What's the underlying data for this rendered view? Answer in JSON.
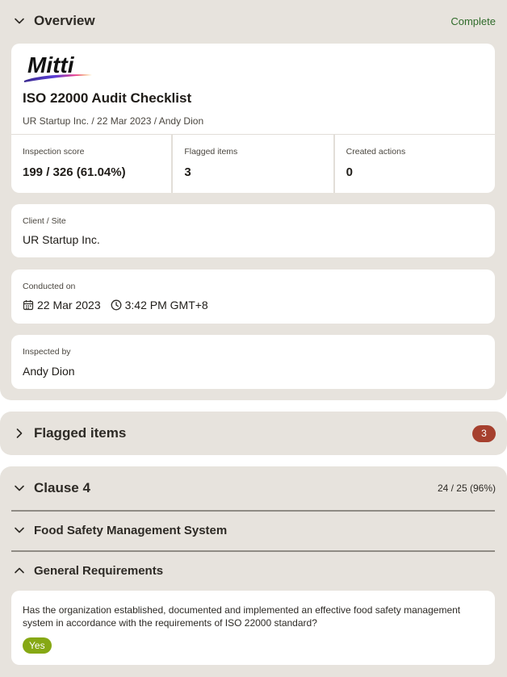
{
  "overview": {
    "title": "Overview",
    "status": "Complete",
    "report": {
      "logo_text": "Mitti",
      "title": "ISO 22000 Audit Checklist",
      "meta": "UR Startup Inc. / 22 Mar 2023 / Andy Dion"
    },
    "stats": [
      {
        "label": "Inspection score",
        "value": "199 / 326 (61.04%)"
      },
      {
        "label": "Flagged items",
        "value": "3"
      },
      {
        "label": "Created actions",
        "value": "0"
      }
    ],
    "client": {
      "label": "Client / Site",
      "value": "UR Startup Inc."
    },
    "conducted": {
      "label": "Conducted on",
      "date": "22 Mar 2023",
      "time": "3:42 PM GMT+8"
    },
    "inspected": {
      "label": "Inspected by",
      "value": "Andy Dion"
    }
  },
  "flagged": {
    "title": "Flagged items",
    "count": "3"
  },
  "clause": {
    "title": "Clause 4",
    "score": "24 / 25 (96%)",
    "subsection": "Food Safety Management System",
    "subsubsection": "General Requirements",
    "question": "Has the organization established, documented and implemented an effective food safety management system in accordance with the requirements of ISO 22000 standard?",
    "answer": "Yes"
  },
  "icons": {
    "collapse": "chevron-down-icon",
    "expand": "chevron-right-icon",
    "collapse_up": "chevron-up-icon",
    "calendar": "calendar-icon",
    "clock": "clock-icon"
  },
  "colors": {
    "panel_bg": "#e7e3dd",
    "complete_text": "#2f6b2a",
    "flag_badge": "#a6402e",
    "answer_yes": "#86a814"
  }
}
